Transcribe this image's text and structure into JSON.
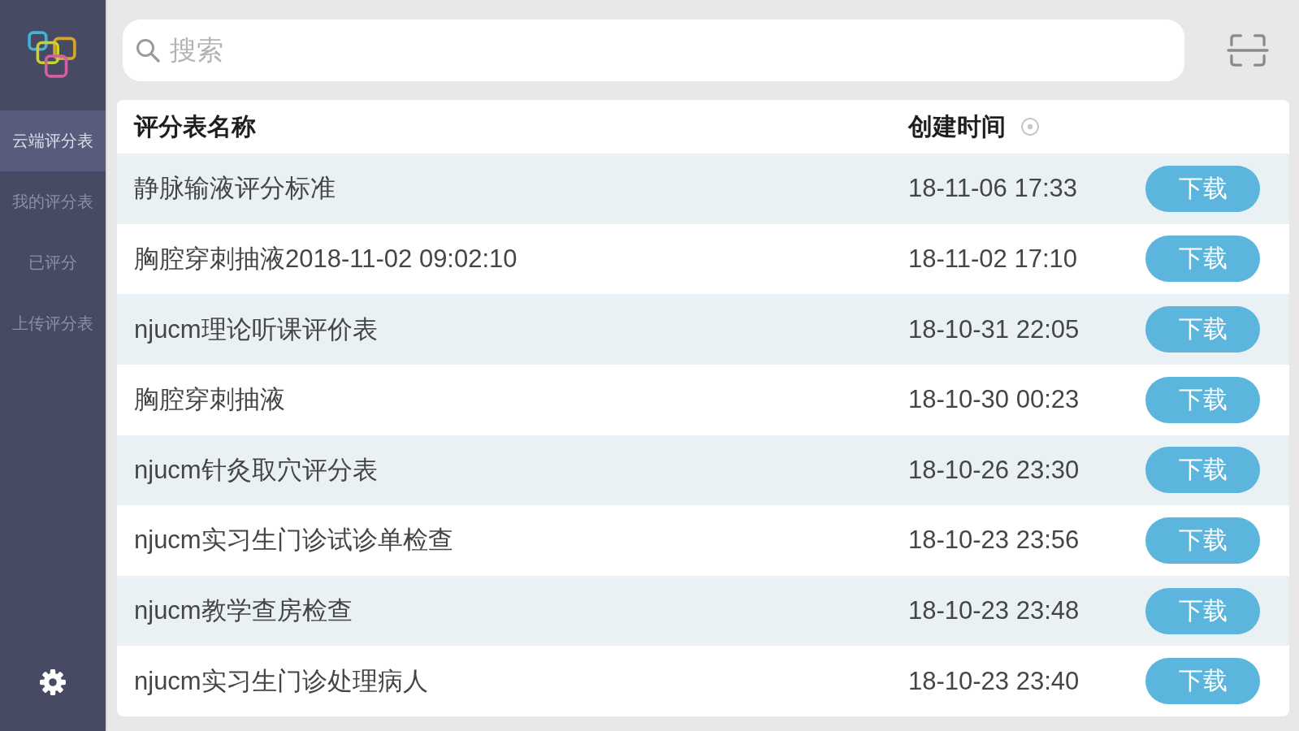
{
  "sidebar": {
    "items": [
      {
        "label": "云端评分表",
        "selected": true
      },
      {
        "label": "我的评分表",
        "selected": false
      },
      {
        "label": "已评分",
        "selected": false
      },
      {
        "label": "上传评分表",
        "selected": false
      }
    ]
  },
  "search": {
    "placeholder": "搜索"
  },
  "table": {
    "columns": [
      {
        "label": "评分表名称",
        "sortable": false
      },
      {
        "label": "创建时间",
        "sortable": true
      }
    ],
    "rows": [
      {
        "name": "静脉输液评分标准",
        "created": "18-11-06 17:33",
        "action": "下载"
      },
      {
        "name": "胸腔穿刺抽液2018-11-02 09:02:10",
        "created": "18-11-02 17:10",
        "action": "下载"
      },
      {
        "name": "njucm理论听课评价表",
        "created": "18-10-31 22:05",
        "action": "下载"
      },
      {
        "name": "胸腔穿刺抽液",
        "created": "18-10-30 00:23",
        "action": "下载"
      },
      {
        "name": "njucm针灸取穴评分表",
        "created": "18-10-26 23:30",
        "action": "下载"
      },
      {
        "name": "njucm实习生门诊试诊单检查",
        "created": "18-10-23 23:56",
        "action": "下载"
      },
      {
        "name": "njucm教学查房检查",
        "created": "18-10-23 23:48",
        "action": "下载"
      },
      {
        "name": "njucm实习生门诊处理病人",
        "created": "18-10-23 23:40",
        "action": "下载"
      }
    ]
  }
}
